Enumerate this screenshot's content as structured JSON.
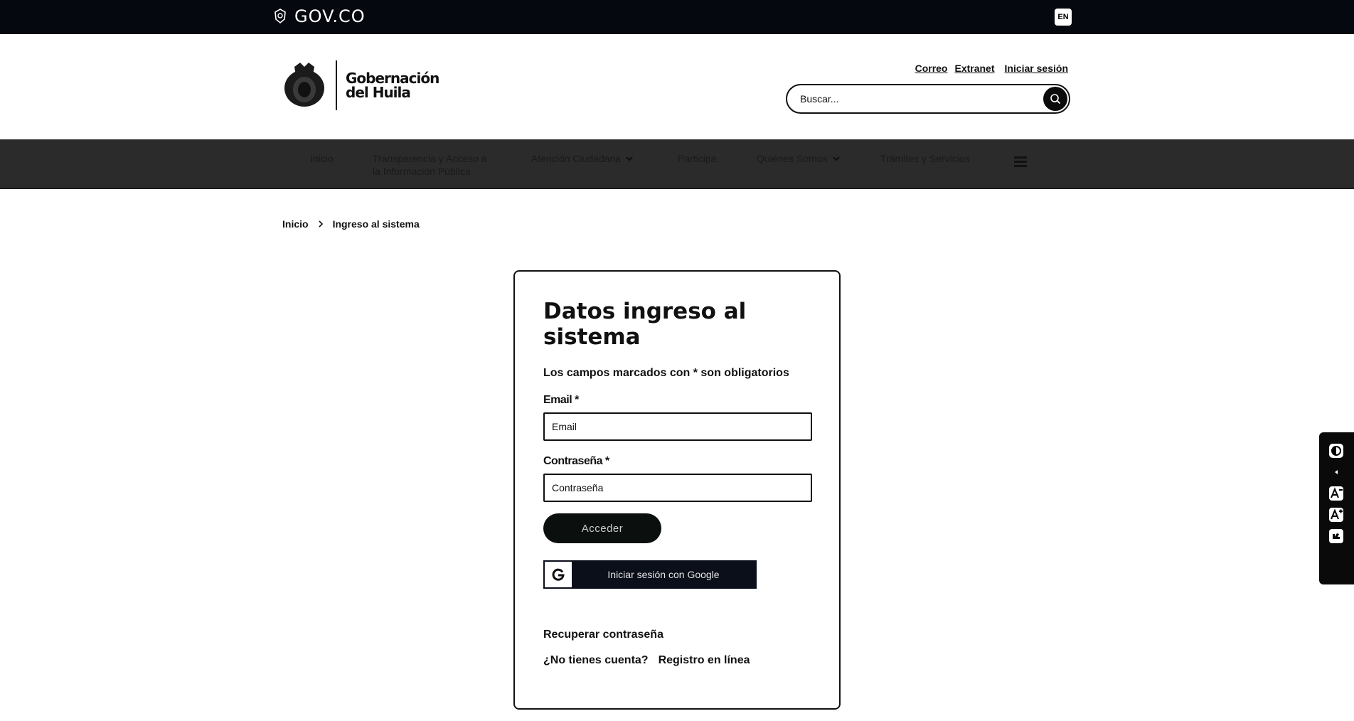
{
  "topbar": {
    "brand": "GOV.CO",
    "lang": "EN"
  },
  "header": {
    "logo_line1": "Gobernación",
    "logo_line2": "del Huila",
    "links": [
      "Correo",
      "Extranet",
      "Iniciar sesión"
    ],
    "search_placeholder": "Buscar..."
  },
  "nav": {
    "items": [
      {
        "label": "Inicio"
      },
      {
        "label": "Transparencia y Acceso a",
        "label2": "la Información Pública"
      },
      {
        "label": "Atención Ciudadana"
      },
      {
        "label": "Participa"
      },
      {
        "label": "Quiénes Somos"
      },
      {
        "label": "Trámites y Servicios"
      }
    ]
  },
  "breadcrumb": {
    "home": "Inicio",
    "current": "Ingreso al sistema"
  },
  "form": {
    "title": "Datos ingreso al sistema",
    "required_note": "Los campos marcados con * son obligatorios",
    "email_label": "Email *",
    "email_placeholder": "Email",
    "password_label": "Contraseña *",
    "password_placeholder": "Contraseña",
    "submit_label": "Acceder",
    "google_label": "Iniciar sesión con Google",
    "recover_label": "Recuperar contraseña",
    "no_account": "¿No tienes cuenta?",
    "register_label": "Registro en línea"
  },
  "colors": {
    "topbar_bg": "#06080f",
    "nav_bg": "#2b2b2b",
    "button_bg": "#0b0f0d"
  },
  "icons": {
    "govco": "shield-icon",
    "search": "search-icon",
    "menu": "menu-icon",
    "contrast": "contrast-icon",
    "collapse": "chevron-left-icon",
    "font_decrease": "font-decrease-icon",
    "font_increase": "font-increase-icon",
    "sign_language": "sign-language-icon"
  }
}
